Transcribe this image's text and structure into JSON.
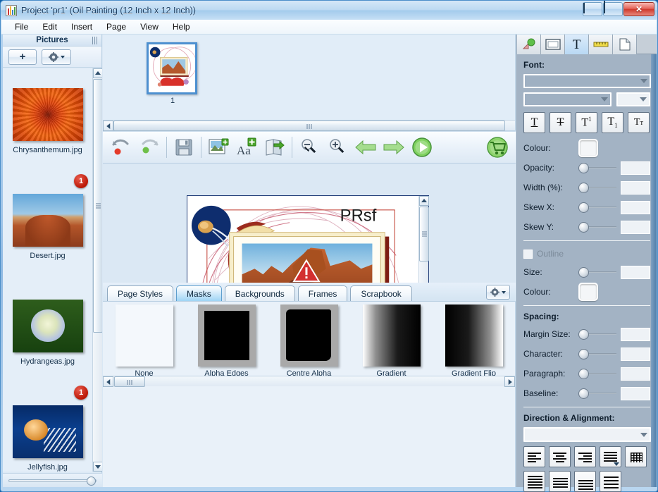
{
  "window": {
    "title": "Project 'pr1' (Oil Painting (12 Inch x 12 Inch))",
    "app_icon": "app-icon",
    "minimize": "–",
    "maximize": "□",
    "close": "✕"
  },
  "menubar": {
    "items": [
      {
        "label": "File"
      },
      {
        "label": "Edit"
      },
      {
        "label": "Insert"
      },
      {
        "label": "Page"
      },
      {
        "label": "View"
      },
      {
        "label": "Help"
      }
    ]
  },
  "pictures_panel": {
    "title": "Pictures",
    "add_button": "+",
    "gear_button": "",
    "items": [
      {
        "label": "Chrysanthemum.jpg",
        "badge": "",
        "thumb_class": "th-chrys"
      },
      {
        "label": "Desert.jpg",
        "badge": "1",
        "thumb_class": "th-desert"
      },
      {
        "label": "Hydrangeas.jpg",
        "badge": "",
        "thumb_class": "th-hydr"
      },
      {
        "label": "Jellyfish.jpg",
        "badge": "1",
        "thumb_class": "th-jelly"
      }
    ]
  },
  "pages_strip": {
    "pages": [
      {
        "number": "1"
      }
    ]
  },
  "toolbar": {
    "buttons": [
      {
        "name": "undo-button",
        "icon": "undo-icon"
      },
      {
        "name": "redo-button",
        "icon": "redo-icon"
      },
      {
        "name": "save-button",
        "icon": "save-icon"
      },
      {
        "name": "add-picture-button",
        "icon": "add-picture-icon"
      },
      {
        "name": "add-text-button",
        "icon": "add-text-icon"
      },
      {
        "name": "export-button",
        "icon": "export-icon"
      },
      {
        "name": "zoom-out-button",
        "icon": "zoom-out-icon"
      },
      {
        "name": "zoom-in-button",
        "icon": "zoom-in-icon"
      },
      {
        "name": "previous-page-button",
        "icon": "arrow-left-icon"
      },
      {
        "name": "next-page-button",
        "icon": "arrow-right-icon"
      },
      {
        "name": "preview-button",
        "icon": "play-icon"
      },
      {
        "name": "buy-button",
        "icon": "shopping-cart-icon"
      }
    ]
  },
  "canvas": {
    "text_object": "PRsf"
  },
  "bottom_tabs": {
    "tabs": [
      {
        "label": "Page Styles",
        "active": false
      },
      {
        "label": "Masks",
        "active": true
      },
      {
        "label": "Backgrounds",
        "active": false
      },
      {
        "label": "Frames",
        "active": false
      },
      {
        "label": "Scrapbook",
        "active": false
      }
    ],
    "settings_button": ""
  },
  "gallery": {
    "items": [
      {
        "label": "None",
        "swatch": "sw-none"
      },
      {
        "label": "Alpha Edges",
        "swatch": "sw-alpha-edges"
      },
      {
        "label": "Centre Alpha",
        "swatch": "sw-centre-alpha"
      },
      {
        "label": "Gradient",
        "swatch": "sw-gradient"
      },
      {
        "label": "Gradient Flip",
        "swatch": "sw-gradient-flip"
      }
    ]
  },
  "right_panel": {
    "tabs": [
      {
        "name": "tab-objects",
        "icon": "shapes-icon",
        "active": false
      },
      {
        "name": "tab-frame",
        "icon": "frame-icon",
        "active": false
      },
      {
        "name": "tab-text",
        "icon": "text-icon",
        "active": true
      },
      {
        "name": "tab-measure",
        "icon": "ruler-icon",
        "active": false
      },
      {
        "name": "tab-page",
        "icon": "page-icon",
        "active": false
      }
    ],
    "font": {
      "heading": "Font:",
      "family_value": "",
      "style_value": "",
      "size_value": "",
      "style_buttons": [
        {
          "name": "underline-button",
          "glyph": "T"
        },
        {
          "name": "strikethrough-button",
          "glyph": "T"
        },
        {
          "name": "superscript-button",
          "glyph": "T"
        },
        {
          "name": "subscript-button",
          "glyph": "T"
        },
        {
          "name": "small-caps-button",
          "glyph": "Tт"
        }
      ],
      "colour_label": "Colour:",
      "colour_value": "#f4f6f8",
      "opacity_label": "Opacity:",
      "opacity_value": "",
      "width_label": "Width (%):",
      "width_value": "",
      "skew_x_label": "Skew X:",
      "skew_x_value": "",
      "skew_y_label": "Skew Y:",
      "skew_y_value": ""
    },
    "outline": {
      "checkbox_label": "Outline",
      "checked": false,
      "size_label": "Size:",
      "size_value": "",
      "colour_label": "Colour:",
      "colour_value": "#f4f6f8"
    },
    "spacing": {
      "heading": "Spacing:",
      "margin_size_label": "Margin Size:",
      "margin_size_value": "",
      "character_label": "Character:",
      "character_value": "",
      "paragraph_label": "Paragraph:",
      "paragraph_value": "",
      "baseline_label": "Baseline:",
      "baseline_value": ""
    },
    "direction": {
      "heading": "Direction & Alignment:",
      "select_value": "",
      "buttons": [
        {
          "name": "align-left-button"
        },
        {
          "name": "align-centre-button"
        },
        {
          "name": "align-right-button"
        },
        {
          "name": "align-justify-button"
        },
        {
          "name": "align-grid-button"
        },
        {
          "name": "vertical-align-top-button"
        },
        {
          "name": "vertical-align-middle-button"
        },
        {
          "name": "vertical-align-bottom-button"
        },
        {
          "name": "vertical-align-stretch-button"
        }
      ]
    }
  }
}
